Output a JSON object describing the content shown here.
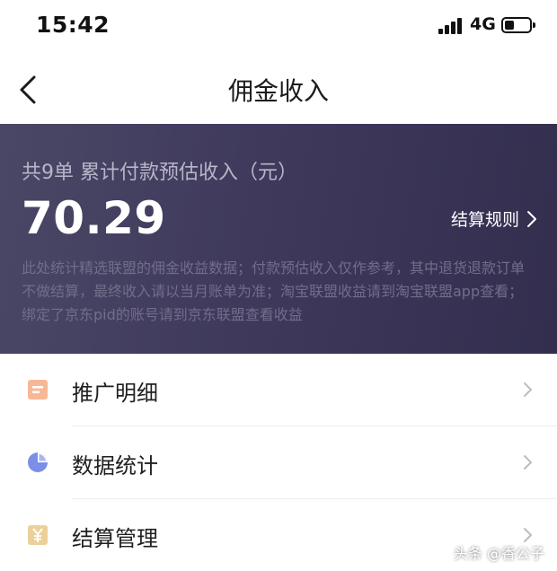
{
  "status_bar": {
    "time": "15:42",
    "network": "4G",
    "battery_level_percent": 40
  },
  "nav": {
    "title": "佣金收入",
    "back_icon": "chevron-left-icon"
  },
  "summary": {
    "label": "共9单 累计付款预估收入（元）",
    "amount": "70.29",
    "rules_link": "结算规则",
    "note": "此处统计精选联盟的佣金收益数据；付款预估收入仅作参考，其中退货退款订单不做结算，最终收入请以当月账单为准；淘宝联盟收益请到淘宝联盟app查看；绑定了京东pid的账号请到京东联盟查看收益",
    "gradient_colors": [
      "#4a4766",
      "#332e4e"
    ]
  },
  "menu": [
    {
      "label": "推广明细",
      "icon": "document-list-icon",
      "icon_color": "#f4a07a"
    },
    {
      "label": "数据统计",
      "icon": "pie-chart-icon",
      "icon_color": "#6f86e6"
    },
    {
      "label": "结算管理",
      "icon": "yen-icon",
      "icon_color": "#e6c27a"
    }
  ],
  "watermark": "头条 @香公子"
}
